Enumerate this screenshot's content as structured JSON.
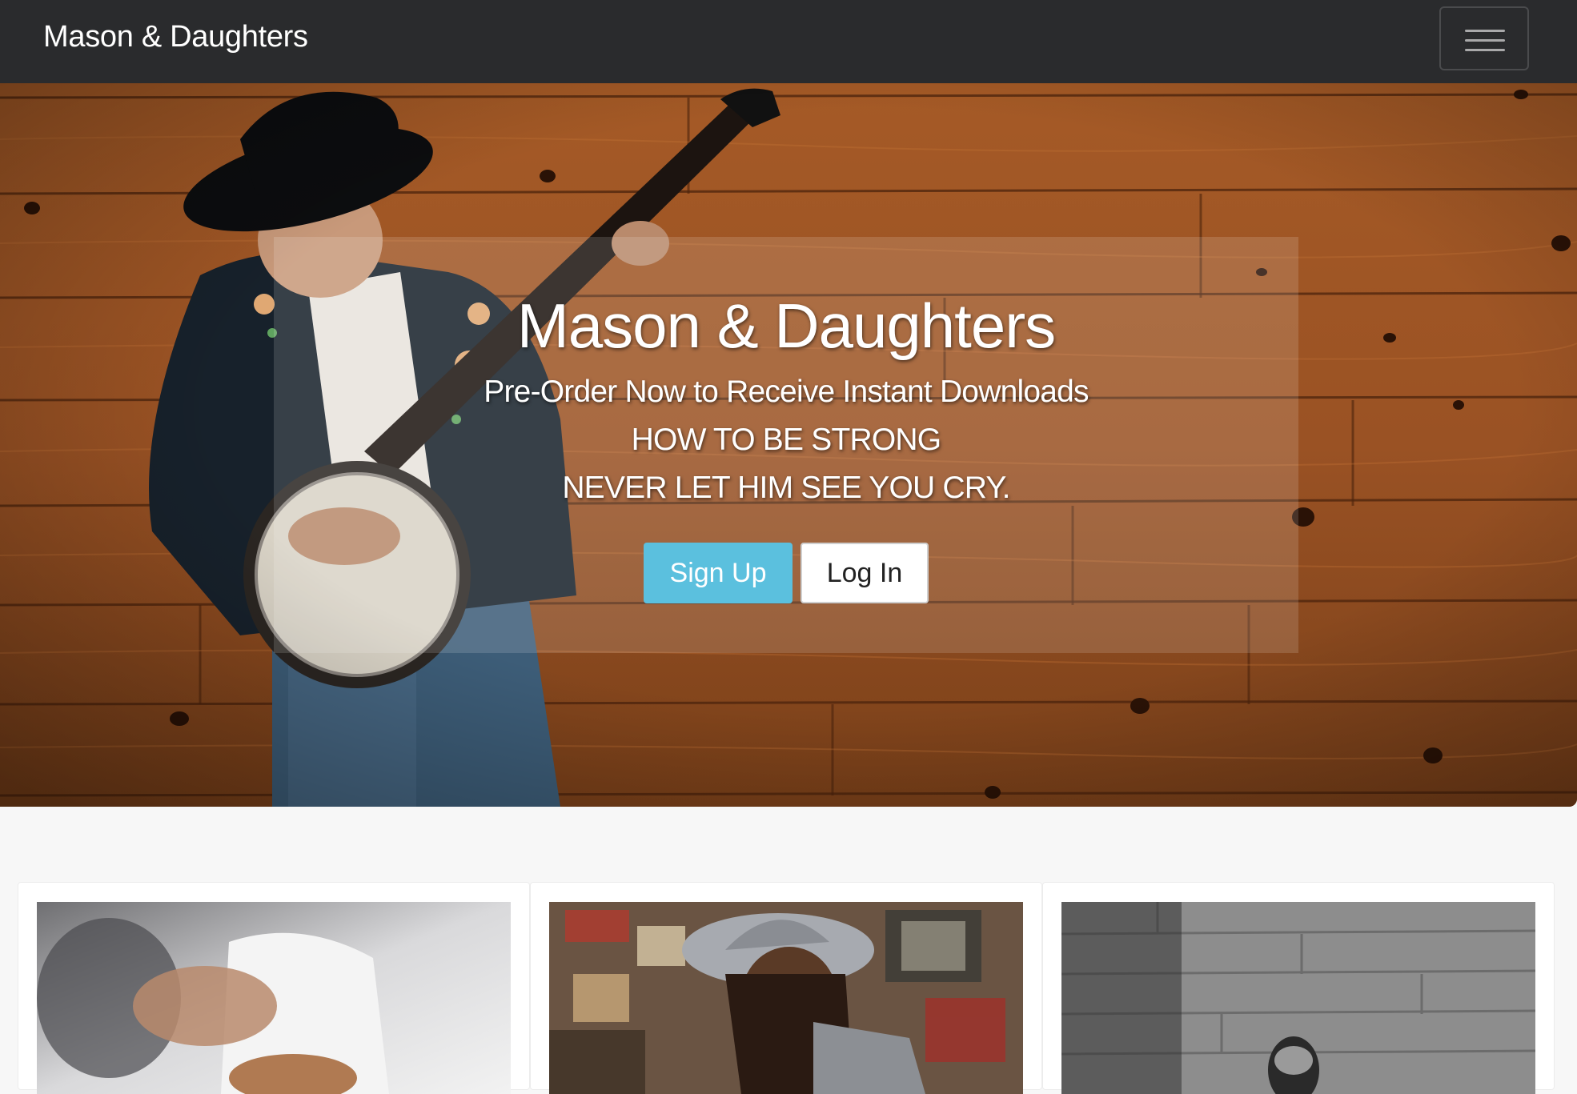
{
  "navbar": {
    "brand": "Mason & Daughters",
    "menu_icon": "hamburger-icon"
  },
  "hero": {
    "title": "Mason & Daughters",
    "lines": [
      "Pre-Order Now to Receive Instant Downloads",
      "HOW TO BE STRONG",
      "NEVER LET HIM SEE YOU CRY."
    ],
    "signup_label": "Sign Up",
    "login_label": "Log In",
    "background_image": "banjo-player-wood-wall-photo"
  },
  "cards": [
    {
      "image": "guitar-player-photo"
    },
    {
      "image": "woman-with-hat-photo"
    },
    {
      "image": "microphone-photo"
    }
  ],
  "colors": {
    "navbar": "#2a2b2d",
    "signup": "#5bc0de",
    "page_bg": "#f7f7f7"
  }
}
